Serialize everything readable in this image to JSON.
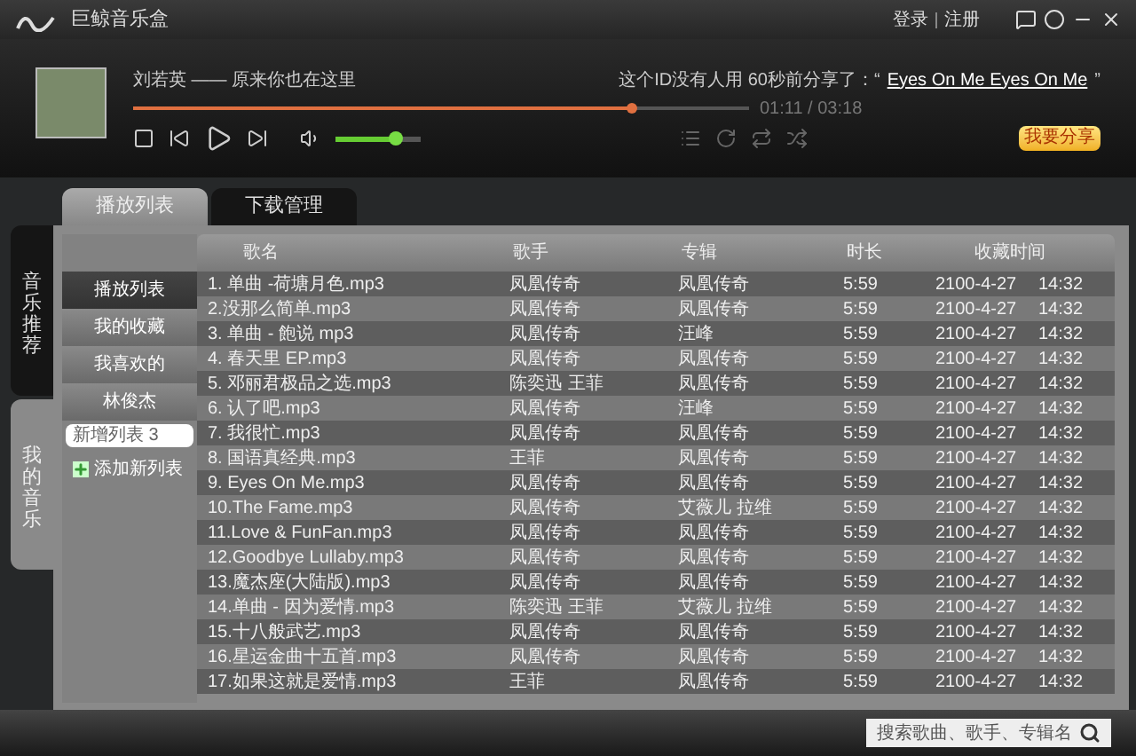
{
  "window": {
    "title": "巨鲸音乐盒",
    "links": [
      "登录",
      "注册"
    ]
  },
  "player": {
    "now_playing": "刘若英 —— 原来你也在这里",
    "share_text": "这个ID没有人用 60秒前分享了：“",
    "share_link": "Eyes On Me Eyes On Me",
    "share_close": "”",
    "progress": {
      "level": 0.81
    },
    "time": "01:11 / 03:18",
    "volume": {
      "level": 0.7
    },
    "share_button": "我要分享"
  },
  "tabs": [
    {
      "label": "播放列表",
      "selected": true
    },
    {
      "label": "下载管理",
      "selected": false
    }
  ],
  "side_tabs": [
    {
      "label": "音乐推荐",
      "selected": false
    },
    {
      "label": "我的音乐",
      "selected": true
    }
  ],
  "playlists": {
    "items": [
      {
        "label": "播放列表",
        "selected": true
      },
      {
        "label": "我的收藏",
        "selected": false
      },
      {
        "label": "我喜欢的",
        "selected": false
      },
      {
        "label": "林俊杰",
        "selected": false
      }
    ],
    "new_list_value": "新增列表 3",
    "add_label": "添加新列表"
  },
  "table": {
    "columns": [
      "歌名",
      "歌手",
      "专辑",
      "时长",
      "收藏时间"
    ],
    "rows": [
      [
        "1. 单曲 -荷塘月色.mp3",
        "凤凰传奇",
        "凤凰传奇",
        "5:59",
        "2100-4-27",
        "14:32"
      ],
      [
        "2.没那么简单.mp3",
        "凤凰传奇",
        "凤凰传奇",
        "5:59",
        "2100-4-27",
        "14:32"
      ],
      [
        "3. 单曲 - 飽说 mp3",
        "凤凰传奇",
        "汪峰",
        "5:59",
        "2100-4-27",
        "14:32"
      ],
      [
        "4. 春天里 EP.mp3",
        "凤凰传奇",
        "凤凰传奇",
        "5:59",
        "2100-4-27",
        "14:32"
      ],
      [
        "5. 邓丽君极品之选.mp3",
        "陈奕迅 王菲",
        "凤凰传奇",
        "5:59",
        "2100-4-27",
        "14:32"
      ],
      [
        "6. 认了吧.mp3",
        "凤凰传奇",
        "汪峰",
        "5:59",
        "2100-4-27",
        "14:32"
      ],
      [
        "7. 我很忙.mp3",
        "凤凰传奇",
        "凤凰传奇",
        "5:59",
        "2100-4-27",
        "14:32"
      ],
      [
        "8. 国语真经典.mp3",
        "王菲",
        "凤凰传奇",
        "5:59",
        "2100-4-27",
        "14:32"
      ],
      [
        "9. Eyes On Me.mp3",
        "凤凰传奇",
        "凤凰传奇",
        "5:59",
        "2100-4-27",
        "14:32"
      ],
      [
        "10.The Fame.mp3",
        "凤凰传奇",
        "艾薇儿 拉维",
        "5:59",
        "2100-4-27",
        "14:32"
      ],
      [
        "11.Love & FunFan.mp3",
        "凤凰传奇",
        "凤凰传奇",
        "5:59",
        "2100-4-27",
        "14:32"
      ],
      [
        "12.Goodbye Lullaby.mp3",
        "凤凰传奇",
        "凤凰传奇",
        "5:59",
        "2100-4-27",
        "14:32"
      ],
      [
        "13.魔杰座(大陆版).mp3",
        "凤凰传奇",
        "凤凰传奇",
        "5:59",
        "2100-4-27",
        "14:32"
      ],
      [
        "14.单曲 - 因为爱情.mp3",
        "陈奕迅 王菲",
        "艾薇儿 拉维",
        "5:59",
        "2100-4-27",
        "14:32"
      ],
      [
        "15.十八般武艺.mp3",
        "凤凰传奇",
        "凤凰传奇",
        "5:59",
        "2100-4-27",
        "14:32"
      ],
      [
        "16.星运金曲十五首.mp3",
        "凤凰传奇",
        "凤凰传奇",
        "5:59",
        "2100-4-27",
        "14:32"
      ],
      [
        "17.如果这就是爱情.mp3",
        "王菲",
        "凤凰传奇",
        "5:59",
        "2100-4-27",
        "14:32"
      ]
    ]
  },
  "search": {
    "placeholder": "搜索歌曲、歌手、专辑名"
  }
}
